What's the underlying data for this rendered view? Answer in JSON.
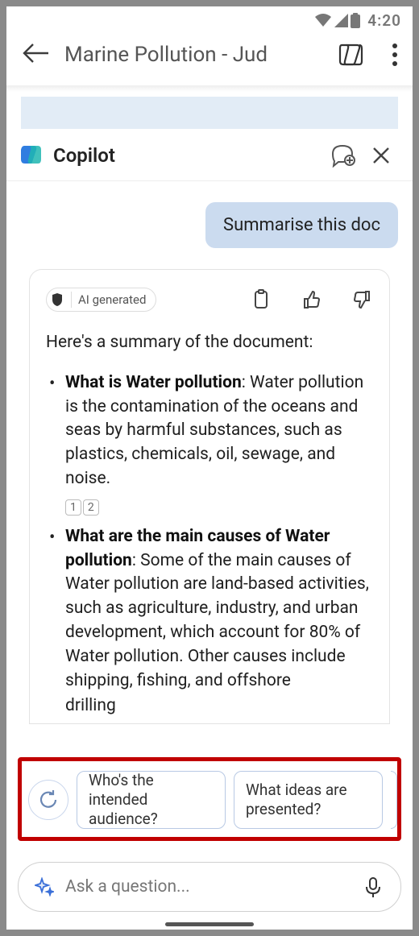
{
  "status": {
    "time": "4:20"
  },
  "header": {
    "doc_title": "Marine Pollution - Jud"
  },
  "copilot": {
    "title": "Copilot"
  },
  "conversation": {
    "user_message": "Summarise this doc",
    "ai_badge": "AI generated",
    "intro": "Here's a summary of the document:",
    "bullets": [
      {
        "title": "What is Water pollution",
        "body": ": Water pollution is the contamination of the oceans and seas by harmful substances, such as plastics, chemicals, oil, sewage, and noise.",
        "citations": [
          "1",
          "2"
        ]
      },
      {
        "title": "What are the main causes of Water pollution",
        "body": ": Some of the main causes of Water pollution are land-based activities, such as agriculture, industry, and urban development, which account for 80% of Water pollution. Other causes include shipping, fishing, and offshore",
        "citations": []
      }
    ],
    "trailing": "drilling"
  },
  "suggestions": {
    "s1": "Who's the intended audience?",
    "s2": "What ideas are presented?"
  },
  "input": {
    "placeholder": "Ask a question..."
  }
}
